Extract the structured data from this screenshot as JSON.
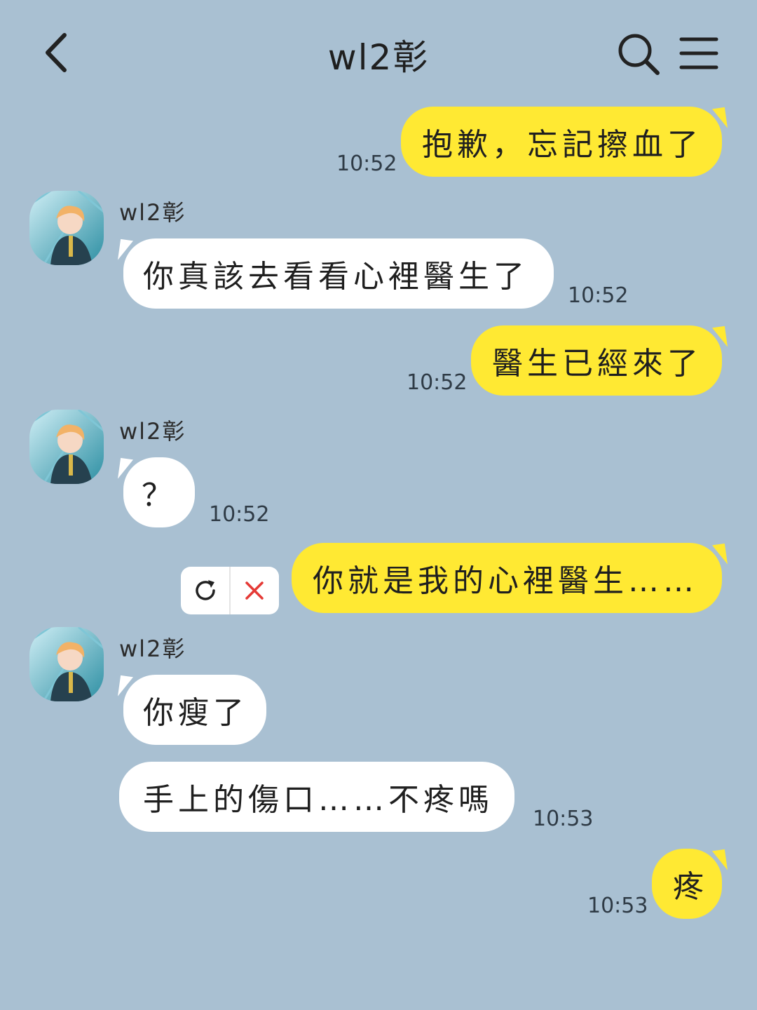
{
  "header": {
    "title": "wl2彰",
    "icons": {
      "back": "chevron-left-icon",
      "search": "search-icon",
      "menu": "hamburger-menu-icon"
    }
  },
  "colors": {
    "background": "#a9c0d2",
    "outgoing_bubble": "#ffe933",
    "incoming_bubble": "#ffffff",
    "resend_error": "#e53935"
  },
  "messages": [
    {
      "side": "me",
      "text": "抱歉，忘記擦血了",
      "time": "10:52"
    },
    {
      "side": "them",
      "sender": "wl2彰",
      "text": "你真該去看看心裡醫生了",
      "time": "10:52"
    },
    {
      "side": "me",
      "text": "醫生已經來了",
      "time": "10:52"
    },
    {
      "side": "them",
      "sender": "wl2彰",
      "text": "？",
      "time": "10:52"
    },
    {
      "side": "me",
      "text": "你就是我的心裡醫生……",
      "status": "failed"
    },
    {
      "side": "them",
      "sender": "wl2彰",
      "text": "你瘦了"
    },
    {
      "side": "them",
      "text": "手上的傷口……不疼嗎",
      "time": "10:53"
    },
    {
      "side": "me",
      "text": "疼",
      "time": "10:53"
    }
  ],
  "failed_actions": {
    "retry_icon": "retry-icon",
    "delete_icon": "close-icon"
  }
}
